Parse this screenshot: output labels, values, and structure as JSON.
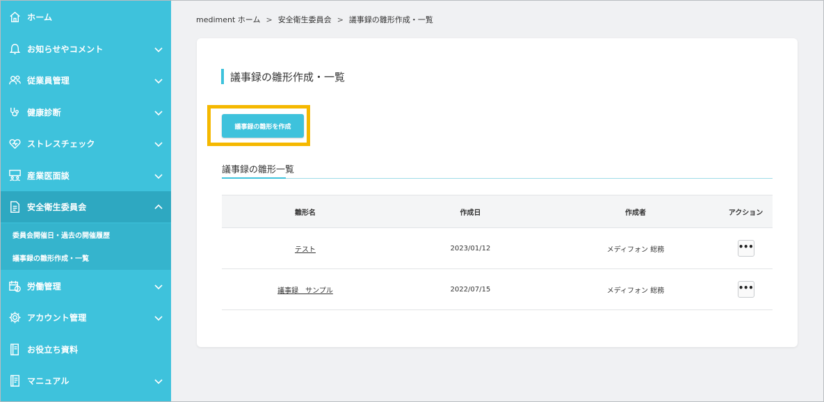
{
  "sidebar": {
    "items": [
      {
        "label": "ホーム",
        "icon": "home-icon",
        "has_chevron": false
      },
      {
        "label": "お知らせやコメント",
        "icon": "bell-icon",
        "has_chevron": true
      },
      {
        "label": "従業員管理",
        "icon": "users-icon",
        "has_chevron": true
      },
      {
        "label": "健康診断",
        "icon": "stethoscope-icon",
        "has_chevron": true
      },
      {
        "label": "ストレスチェック",
        "icon": "heart-icon",
        "has_chevron": true
      },
      {
        "label": "産業医面談",
        "icon": "interview-icon",
        "has_chevron": true
      },
      {
        "label": "安全衛生委員会",
        "icon": "document-icon",
        "has_chevron": true,
        "expanded": true
      },
      {
        "label": "労働管理",
        "icon": "calendar-clock-icon",
        "has_chevron": true
      },
      {
        "label": "アカウント管理",
        "icon": "gear-icon",
        "has_chevron": true
      },
      {
        "label": "お役立ち資料",
        "icon": "book-icon",
        "has_chevron": false
      },
      {
        "label": "マニュアル",
        "icon": "manual-icon",
        "has_chevron": true
      }
    ],
    "subitems": [
      {
        "label": "委員会開催日・過去の開催履歴"
      },
      {
        "label": "議事録の雛形作成・一覧"
      }
    ]
  },
  "breadcrumb": [
    "mediment ホーム",
    "安全衛生委員会",
    "議事録の雛形作成・一覧"
  ],
  "breadcrumb_sep": ">",
  "page": {
    "title": "議事録の雛形作成・一覧",
    "create_button": "議事録の雛形を作成",
    "section_title": "議事録の雛形一覧"
  },
  "table": {
    "headers": [
      "雛形名",
      "作成日",
      "作成者",
      "アクション"
    ],
    "rows": [
      {
        "name": "テスト",
        "date": "2023/01/12",
        "author": "メディフォン 総務",
        "action": "•••"
      },
      {
        "name": "議事録　サンプル",
        "date": "2022/07/15",
        "author": "メディフォン 総務",
        "action": "•••"
      }
    ]
  },
  "colors": {
    "sidebar": "#3ec2dc",
    "sidebar_active": "#2ea8c1",
    "highlight": "#f5b800"
  }
}
